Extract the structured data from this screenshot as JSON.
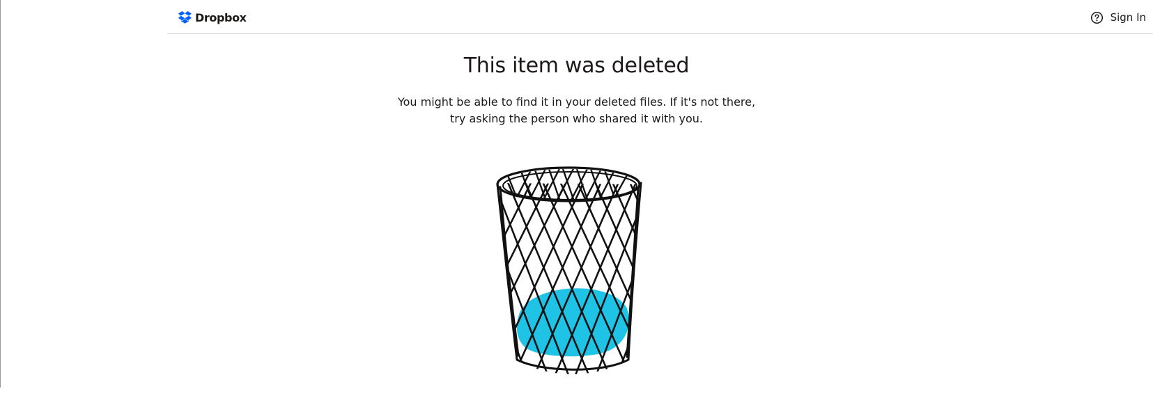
{
  "header": {
    "brand_name": "Dropbox",
    "brand_color": "#0061fe",
    "help_icon": "question-circle-icon",
    "signin_label": "Sign In"
  },
  "main": {
    "title": "This item was deleted",
    "message_line1": "You might be able to find it in your deleted files. If it's not there,",
    "message_line2": "try asking the person who shared it with you."
  },
  "illustration": {
    "name": "wastebasket",
    "accent_color": "#1ec3e6"
  }
}
